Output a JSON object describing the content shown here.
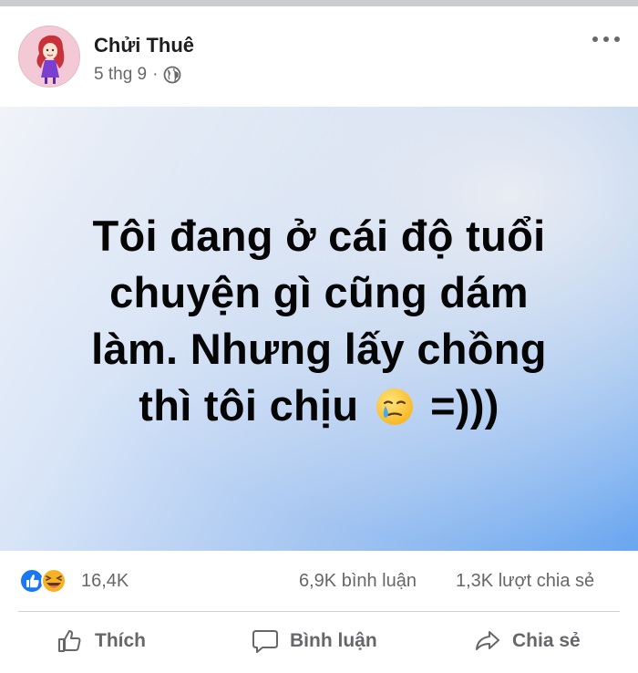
{
  "post": {
    "author": "Chửi Thuê",
    "date": "5 thg 9",
    "separator": "·",
    "text_lines": [
      "Tôi đang ở cái độ tuổi",
      "chuyện gì cũng dám",
      "làm. Nhưng lấy chồng",
      "thì tôi chịu",
      "=)))"
    ]
  },
  "stats": {
    "reactions_count": "16,4K",
    "comments_count": "6,9K bình luận",
    "shares_count": "1,3K lượt chia sẻ"
  },
  "actions": {
    "like_label": "Thích",
    "comment_label": "Bình luận",
    "share_label": "Chia sẻ"
  },
  "colors": {
    "secondary_text": "#65676b",
    "like_blue": "#1877f2",
    "haha_yellow": "#f7b125"
  },
  "icons": {
    "privacy": "globe-icon",
    "more": "more-options-icon",
    "emoji": "smiling-face-with-tear-emoji"
  }
}
